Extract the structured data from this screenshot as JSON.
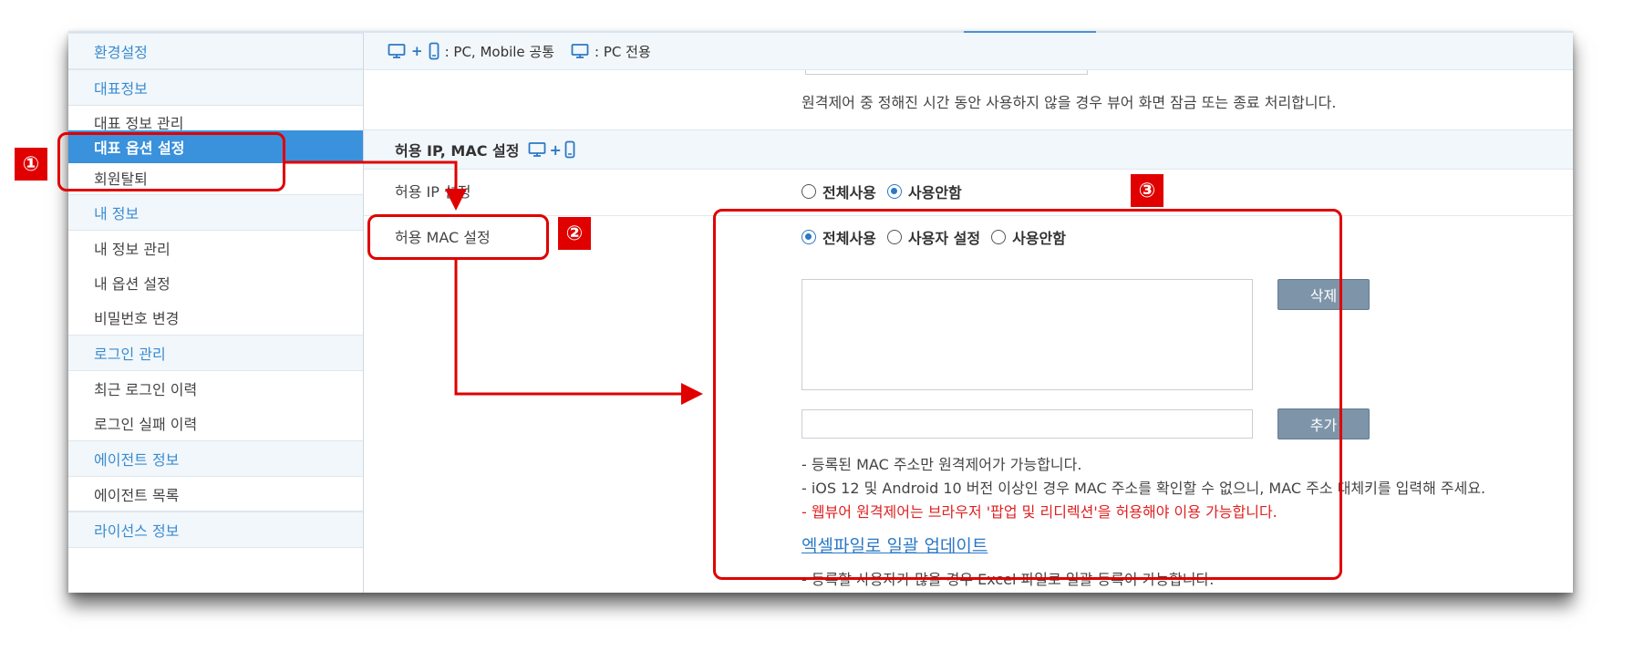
{
  "legend": {
    "both_label": ": PC, Mobile 공통",
    "pc_label": ": PC 전용"
  },
  "sidebar": {
    "items": [
      {
        "label": "환경설정",
        "type": "section"
      },
      {
        "label": "대표정보",
        "type": "section"
      },
      {
        "label": "대표 정보 관리",
        "type": "item"
      },
      {
        "label": "대표 옵션 설정",
        "type": "active"
      },
      {
        "label": "회원탈퇴",
        "type": "item"
      },
      {
        "label": "내 정보",
        "type": "section"
      },
      {
        "label": "내 정보 관리",
        "type": "item"
      },
      {
        "label": "내 옵션 설정",
        "type": "item"
      },
      {
        "label": "비밀번호 변경",
        "type": "item"
      },
      {
        "label": "로그인 관리",
        "type": "section"
      },
      {
        "label": "최근 로그인 이력",
        "type": "item"
      },
      {
        "label": "로그인 실패 이력",
        "type": "item"
      },
      {
        "label": "에이전트 정보",
        "type": "section"
      },
      {
        "label": "에이전트 목록",
        "type": "item"
      },
      {
        "label": "라이선스 정보",
        "type": "section"
      }
    ]
  },
  "content": {
    "timeout_desc": "원격제어 중 정해진 시간 동안 사용하지 않을 경우 뷰어 화면 잠금 또는 종료 처리합니다.",
    "section_title": "허용 IP, MAC 설정",
    "ip_label": "허용 IP 설정",
    "ip_options": [
      "전체사용",
      "사용안함"
    ],
    "mac_label": "허용 MAC 설정",
    "mac_options": [
      "전체사용",
      "사용자 설정",
      "사용안함"
    ],
    "delete_button": "삭제",
    "add_button": "추가",
    "note1": "- 등록된 MAC 주소만 원격제어가 가능합니다.",
    "note2": "- iOS 12 및 Android 10 버전 이상인 경우 MAC 주소를 확인할 수 없으니, MAC 주소 대체키를 입력해 주세요.",
    "note3": "- 웹뷰어 원격제어는 브라우저 '팝업 및 리디렉션'을 허용해야 이용 가능합니다.",
    "excel_link": "엑셀파일로 일괄 업데이트",
    "excel_note": "- 등록할 사용자가 많을 경우 Excel 파일로 일괄 등록이 가능합니다."
  },
  "annotations": {
    "badge1": "①",
    "badge2": "②",
    "badge3": "③"
  },
  "colors": {
    "accent": "#3a91dc",
    "annotation": "#e00000",
    "warning_text": "#e02020"
  }
}
